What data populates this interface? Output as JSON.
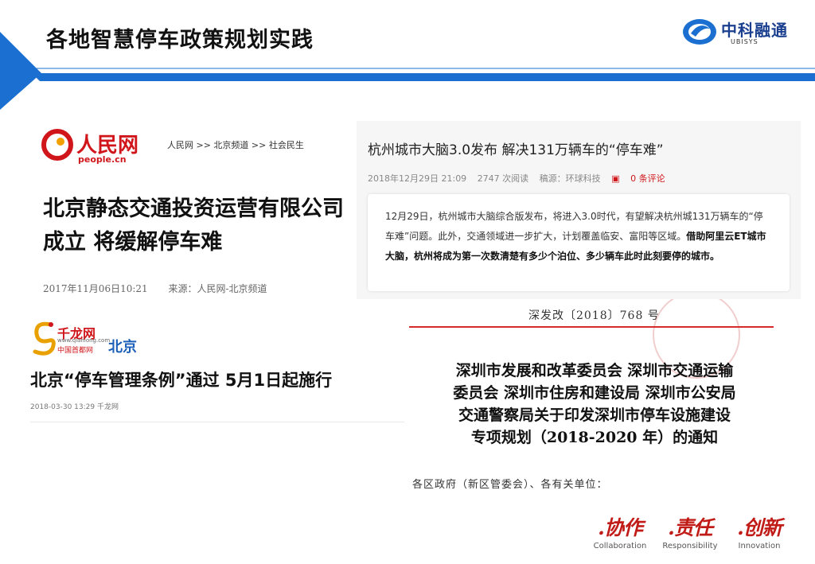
{
  "slide": {
    "title": "各地智慧停车政策规划实践"
  },
  "brand": {
    "name": "中科融通",
    "sub": "UBISYS",
    "primary_color": "#1a6fd0",
    "accent_color": "#d0161b"
  },
  "clip_peoples_daily": {
    "site_name": "人民网",
    "site_domain": "people.cn",
    "breadcrumb": "人民网 >> 北京频道 >> 社会民生",
    "headline_line1": "北京静态交通投资运营有限公司",
    "headline_line2": "成立 将缓解停车难",
    "date": "2017年11月06日10:21",
    "source": "来源：人民网-北京频道"
  },
  "clip_hangzhou": {
    "title": "杭州城市大脑3.0发布 解决131万辆车的“停车难”",
    "date": "2018年12月29日 21:09",
    "reads": "2747 次阅读",
    "source": "稿源：环球科技",
    "comments": "0 条评论",
    "body_plain": "12月29日，杭州城市大脑综合版发布，将进入3.0时代，有望解决杭州城131万辆车的“停车难”问题。此外，交通领域进一步扩大，计划覆盖临安、富阳等区域。",
    "body_bold": "借助阿里云ET城市大脑，杭州将成为第一次数清楚有多少个泊位、多少辆车此时此刻要停的城市。"
  },
  "clip_qianlong": {
    "site_name": "千龙网",
    "site_domain": "www.qianlong.com",
    "site_sub": "中国首都网",
    "region": "北京",
    "headline": "北京“停车管理条例”通过 5月1日起施行",
    "meta": "2018-03-30 13:29 千龙网"
  },
  "clip_shenzhen": {
    "doc_number": "深发改〔2018〕768 号",
    "title_lines": [
      "深圳市发展和改革委员会 深圳市交通运输",
      "委员会 深圳市住房和建设局 深圳市公安局",
      "交通警察局关于印发深圳市停车设施建设",
      "专项规划（2018-2020 年）的通知"
    ],
    "greeting": "各区政府（新区管委会）、各有关单位："
  },
  "motto": [
    {
      "cn": ".协作",
      "en": "Collaboration"
    },
    {
      "cn": ".责任",
      "en": "Responsibility"
    },
    {
      "cn": ".创新",
      "en": "Innovation"
    }
  ]
}
